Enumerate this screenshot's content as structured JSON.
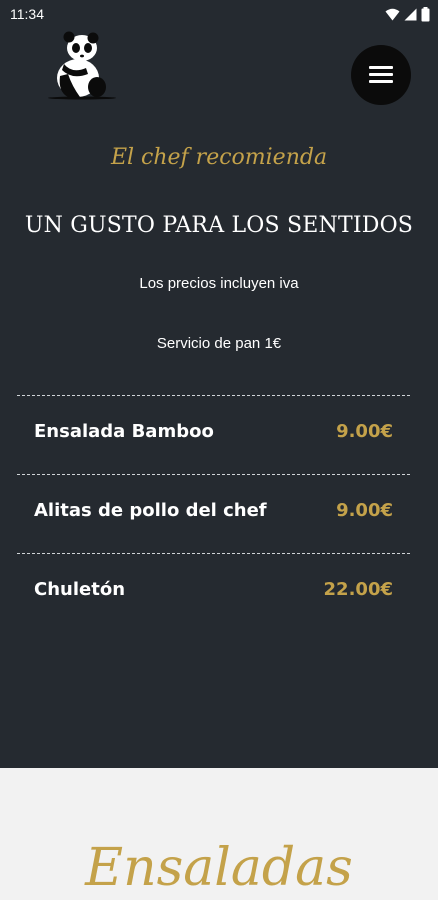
{
  "status_bar": {
    "time": "11:34",
    "icons": [
      "wifi-icon",
      "signal-icon",
      "battery-icon"
    ]
  },
  "header": {
    "logo": "panda-logo",
    "menu_icon": "hamburger-menu-icon"
  },
  "hero": {
    "subtitle": "El chef recomienda",
    "title": "UN GUSTO PARA LOS SENTIDOS",
    "note_iva": "Los precios incluyen iva",
    "note_bread": "Servicio de pan 1€"
  },
  "menu": {
    "items": [
      {
        "name": "Ensalada Bamboo",
        "price": "9.00€"
      },
      {
        "name": "Alitas de pollo del chef",
        "price": "9.00€"
      },
      {
        "name": "Chuletón",
        "price": "22.00€"
      }
    ]
  },
  "next_section": {
    "title": "Ensaladas"
  },
  "colors": {
    "dark_bg": "#252a30",
    "light_bg": "#f2f2f2",
    "accent_gold": "#c4a24a",
    "text_white": "#ffffff"
  }
}
